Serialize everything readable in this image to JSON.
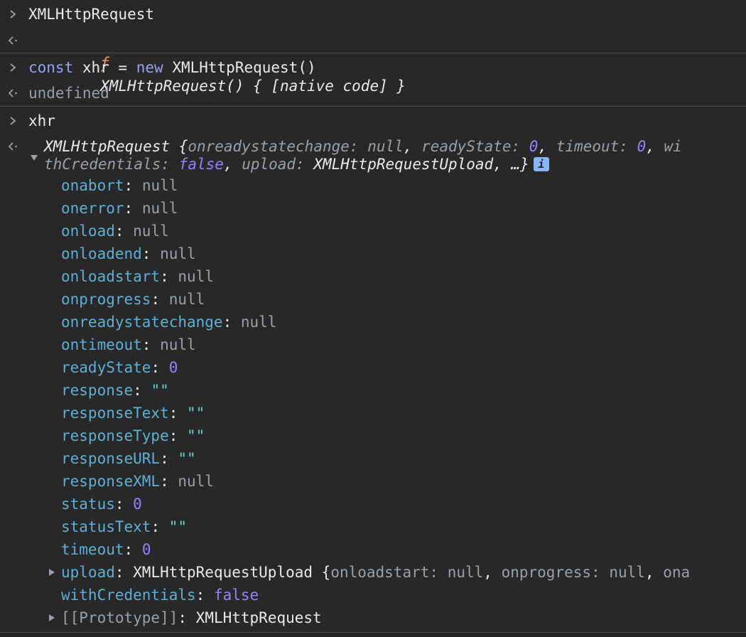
{
  "entries": [
    {
      "input": "XMLHttpRequest",
      "output_f": "ƒ",
      "output": "XMLHttpRequest() { [native code] }"
    },
    {
      "input_kw1": "const",
      "input_mid": " xhr = ",
      "input_kw2": "new",
      "input_end": " XMLHttpRequest()",
      "output": "undefined"
    },
    {
      "input": "xhr"
    }
  ],
  "object": {
    "head1_class": "XMLHttpRequest",
    "head1_brace": " {",
    "head1_p1": "onreadystatechange",
    "head1_v1": "null",
    "head1_p2": "readyState",
    "head1_v2": "0",
    "head1_p3": "timeout",
    "head1_v3": "0",
    "head1_p4a": "wi",
    "head2_p4b": "thCredentials",
    "head2_v4": "false",
    "head2_p5": "upload",
    "head2_v5": "XMLHttpRequestUpload",
    "head2_end": ", …}",
    "info": "i",
    "properties": [
      {
        "key": "onabort",
        "value": "null",
        "type": "null"
      },
      {
        "key": "onerror",
        "value": "null",
        "type": "null"
      },
      {
        "key": "onload",
        "value": "null",
        "type": "null"
      },
      {
        "key": "onloadend",
        "value": "null",
        "type": "null"
      },
      {
        "key": "onloadstart",
        "value": "null",
        "type": "null"
      },
      {
        "key": "onprogress",
        "value": "null",
        "type": "null"
      },
      {
        "key": "onreadystatechange",
        "value": "null",
        "type": "null"
      },
      {
        "key": "ontimeout",
        "value": "null",
        "type": "null"
      },
      {
        "key": "readyState",
        "value": "0",
        "type": "num"
      },
      {
        "key": "response",
        "value": "\"\"",
        "type": "str"
      },
      {
        "key": "responseText",
        "value": "\"\"",
        "type": "str"
      },
      {
        "key": "responseType",
        "value": "\"\"",
        "type": "str"
      },
      {
        "key": "responseURL",
        "value": "\"\"",
        "type": "str"
      },
      {
        "key": "responseXML",
        "value": "null",
        "type": "null"
      },
      {
        "key": "status",
        "value": "0",
        "type": "num"
      },
      {
        "key": "statusText",
        "value": "\"\"",
        "type": "str"
      },
      {
        "key": "timeout",
        "value": "0",
        "type": "num"
      }
    ],
    "upload": {
      "key": "upload",
      "class": "XMLHttpRequestUpload",
      "brace": " {",
      "p1": "onloadstart",
      "v1": "null",
      "p2": "onprogress",
      "v2": "null",
      "p3": "ona"
    },
    "withCredentials": {
      "key": "withCredentials",
      "value": "false"
    },
    "prototype": {
      "key": "[[Prototype]]",
      "value": "XMLHttpRequest"
    }
  }
}
